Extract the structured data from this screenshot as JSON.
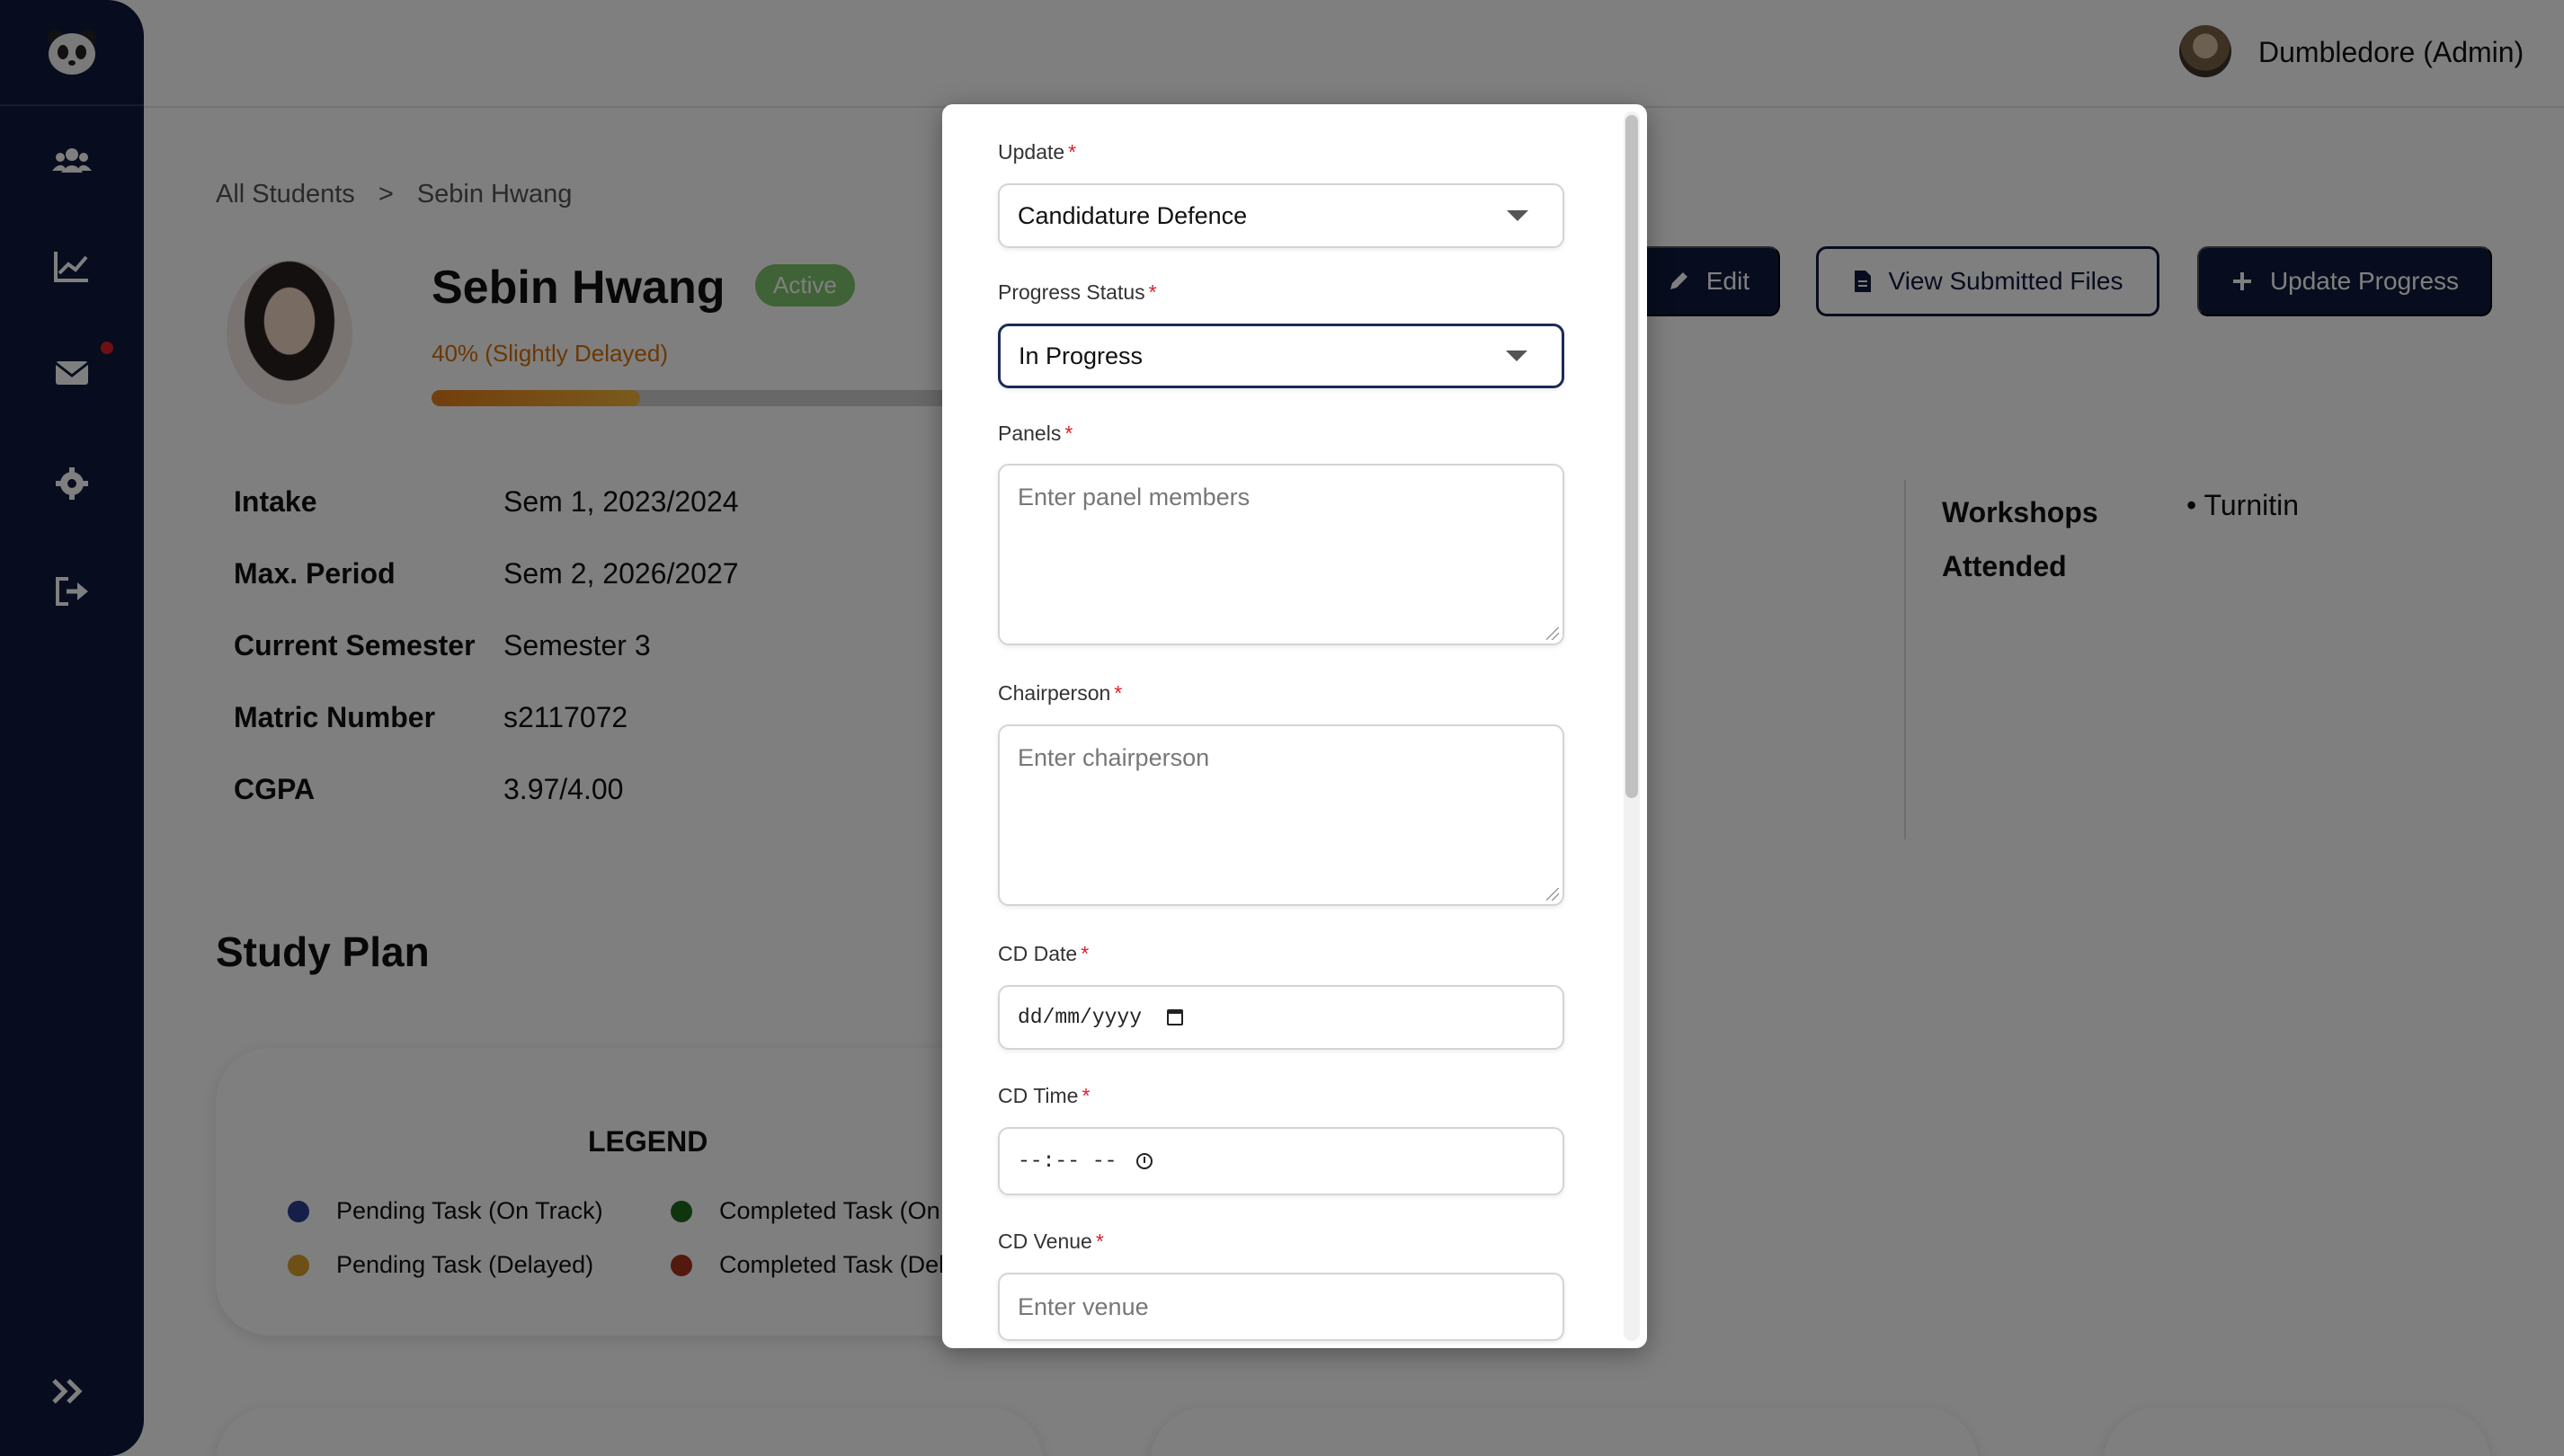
{
  "header": {
    "admin_name": "Dumbledore (Admin)"
  },
  "breadcrumb": {
    "root": "All Students",
    "separator": ">",
    "current": "Sebin Hwang"
  },
  "student": {
    "name": "Sebin Hwang",
    "status": "Active",
    "progress_text": "40% (Slightly Delayed)",
    "progress_fraction": 0.4,
    "info": [
      {
        "label": "Intake",
        "value": "Sem 1, 2023/2024"
      },
      {
        "label": "Max. Period",
        "value": "Sem 2, 2026/2027"
      },
      {
        "label": "Current Semester",
        "value": "Semester 3"
      },
      {
        "label": "Matric Number",
        "value": "s2117072"
      },
      {
        "label": "CGPA",
        "value": "3.97/4.00"
      }
    ],
    "workshops_label": "Workshops Attended",
    "workshops": [
      "Turnitin"
    ]
  },
  "actions": {
    "edit": "Edit",
    "view_files": "View Submitted Files",
    "update_progress": "Update Progress"
  },
  "study_plan": {
    "title": "Study Plan",
    "legend_title": "LEGEND",
    "legend": [
      {
        "label": "Pending Task (On Track)",
        "color": "#2a3f93"
      },
      {
        "label": "Completed Task (On",
        "color": "#1f6b1f"
      },
      {
        "label": "Pending Task (Delayed)",
        "color": "#d8a02a"
      },
      {
        "label": "Completed Task (Del",
        "color": "#a8321c"
      }
    ]
  },
  "modal": {
    "update": {
      "label": "Update",
      "value": "Candidature Defence"
    },
    "progress_status": {
      "label": "Progress Status",
      "value": "In Progress"
    },
    "panels": {
      "label": "Panels",
      "placeholder": "Enter panel members"
    },
    "chairperson": {
      "label": "Chairperson",
      "placeholder": "Enter chairperson"
    },
    "cd_date": {
      "label": "CD Date",
      "value": "dd/mm/yyyy"
    },
    "cd_time": {
      "label": "CD Time",
      "value": "--:-- --"
    },
    "cd_venue": {
      "label": "CD Venue",
      "placeholder": "Enter venue"
    },
    "required_mark": "*"
  },
  "colors": {
    "sidebar": "#0f1b3d",
    "primary": "#0f1b3d",
    "active": "#7fc46c",
    "delayed": "#d4700a",
    "required": "#e11d2a"
  }
}
